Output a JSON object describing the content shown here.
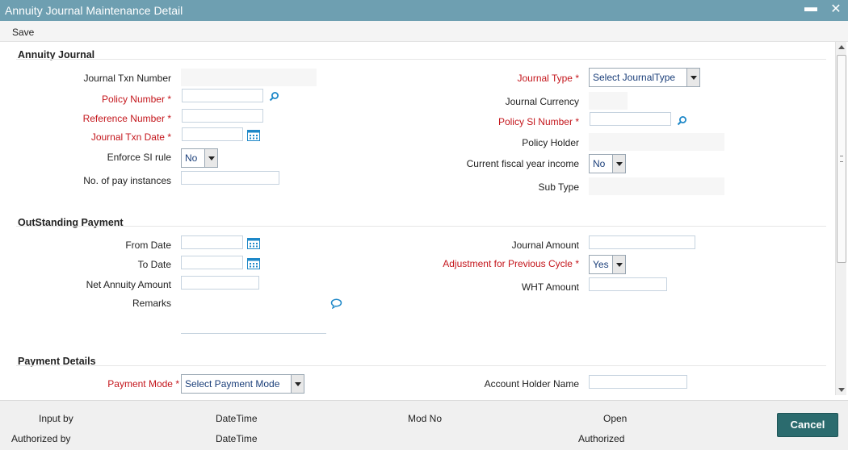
{
  "window": {
    "title": "Annuity Journal Maintenance Detail",
    "minimize_label": "▬",
    "close_label": "✕"
  },
  "toolbar": {
    "save_label": "Save"
  },
  "annuity_journal": {
    "section_title": "Annuity Journal",
    "journal_txn_number": {
      "label": "Journal Txn Number",
      "value": ""
    },
    "policy_number": {
      "label": "Policy Number",
      "value": ""
    },
    "reference_number": {
      "label": "Reference Number",
      "value": ""
    },
    "journal_txn_date": {
      "label": "Journal Txn Date",
      "value": ""
    },
    "enforce_si_rule": {
      "label": "Enforce SI rule",
      "value": "No"
    },
    "no_of_pay_instances": {
      "label": "No. of pay instances",
      "value": ""
    },
    "journal_type": {
      "label": "Journal Type",
      "value": "Select JournalType"
    },
    "journal_currency": {
      "label": "Journal Currency",
      "value": ""
    },
    "policy_sl_number": {
      "label": "Policy Sl Number",
      "value": ""
    },
    "policy_holder": {
      "label": "Policy Holder",
      "value": ""
    },
    "current_fiscal_year_income": {
      "label": "Current fiscal year income",
      "value": "No"
    },
    "sub_type": {
      "label": "Sub Type",
      "value": ""
    }
  },
  "outstanding_payment": {
    "section_title": "OutStanding Payment",
    "from_date": {
      "label": "From Date",
      "value": ""
    },
    "to_date": {
      "label": "To Date",
      "value": ""
    },
    "net_annuity_amount": {
      "label": "Net Annuity Amount",
      "value": ""
    },
    "remarks": {
      "label": "Remarks",
      "value": ""
    },
    "journal_amount": {
      "label": "Journal Amount",
      "value": ""
    },
    "adjustment_previous_cycle": {
      "label": "Adjustment for Previous Cycle",
      "value": "Yes"
    },
    "wht_amount": {
      "label": "WHT Amount",
      "value": ""
    }
  },
  "payment_details": {
    "section_title": "Payment Details",
    "payment_mode": {
      "label": "Payment Mode",
      "value": "Select Payment Mode"
    },
    "account_holder_name": {
      "label": "Account Holder Name",
      "value": ""
    }
  },
  "required_marker": "*",
  "footer": {
    "input_by": "Input by",
    "authorized_by": "Authorized by",
    "datetime_1": "DateTime",
    "datetime_2": "DateTime",
    "mod_no": "Mod No",
    "open": "Open",
    "authorized": "Authorized",
    "cancel_label": "Cancel"
  },
  "icons": {
    "search": "search-icon",
    "calendar": "calendar-icon",
    "remarks": "speech-bubble-icon"
  },
  "colors": {
    "title_bar": "#6e9fb1",
    "required_label": "#c4161c",
    "cancel_button": "#2b6b6e",
    "select_text": "#1b3f7a",
    "icon_blue": "#1e88c8"
  }
}
